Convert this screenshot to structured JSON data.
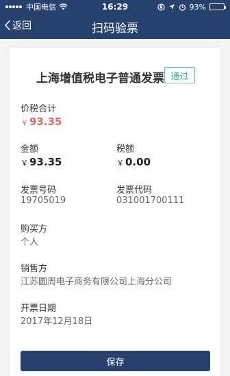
{
  "status_bar": {
    "carrier": "中国电信",
    "time": "16:29",
    "battery": "93%",
    "battery_level": 0.93
  },
  "nav": {
    "back_label": "返回",
    "title": "扫码验票"
  },
  "invoice": {
    "title": "上海增值税电子普通发票",
    "status": "通过",
    "total_label": "价税合计",
    "currency": "￥",
    "total_value": "93.35",
    "amount_label": "金额",
    "amount_value": "93.35",
    "tax_label": "税额",
    "tax_value": "0.00",
    "number_label": "发票号码",
    "number_value": "19705019",
    "code_label": "发票代码",
    "code_value": "031001700111",
    "buyer_label": "购买方",
    "buyer_value": "个人",
    "seller_label": "销售方",
    "seller_value": "江苏圆周电子商务有限公司上海分公司",
    "date_label": "开票日期",
    "date_value": "2017年12月18日"
  },
  "actions": {
    "save_label": "保存"
  },
  "colors": {
    "header": "#27416e",
    "accent_green": "#3fb28d",
    "total_red": "#e06a6a"
  }
}
